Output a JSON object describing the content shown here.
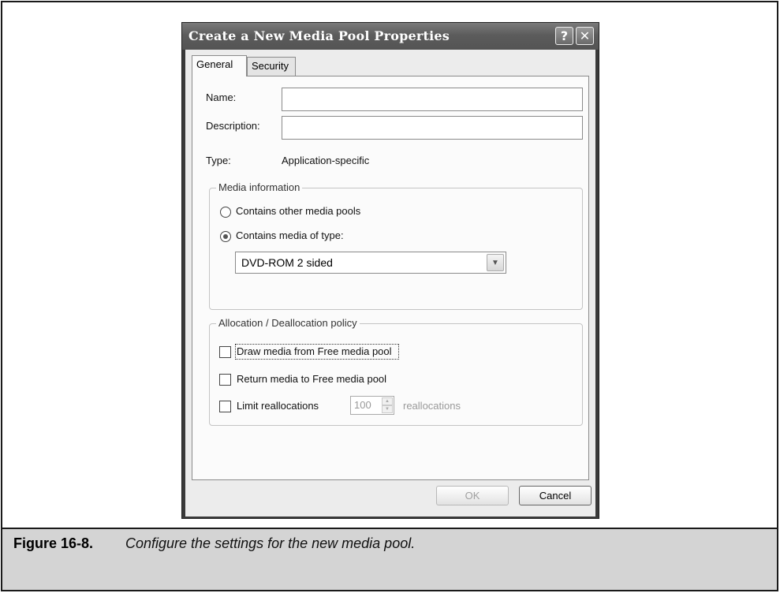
{
  "dialog": {
    "title": "Create a New Media Pool Properties",
    "help_glyph": "?",
    "close_glyph": "✕"
  },
  "tabs": [
    {
      "label": "General",
      "active": true
    },
    {
      "label": "Security",
      "active": false
    }
  ],
  "general": {
    "name_label": "Name:",
    "name_value": "",
    "description_label": "Description:",
    "description_value": "",
    "type_label": "Type:",
    "type_value": "Application-specific"
  },
  "media_info": {
    "group_title": "Media information",
    "radio_other_pools": {
      "label": "Contains other media pools",
      "checked": false
    },
    "radio_media_type": {
      "label": "Contains media of type:",
      "checked": true
    },
    "media_type_selected": "DVD-ROM 2 sided"
  },
  "allocation": {
    "group_title": "Allocation / Deallocation policy",
    "draw_media": {
      "label": "Draw media from Free media pool",
      "checked": false
    },
    "return_media": {
      "label": "Return media to Free media pool",
      "checked": false
    },
    "limit_realloc": {
      "label": "Limit reallocations",
      "checked": false
    },
    "realloc_count": "100",
    "realloc_unit": "reallocations"
  },
  "buttons": {
    "ok": "OK",
    "cancel": "Cancel"
  },
  "caption": {
    "label": "Figure 16-8.",
    "text": "Configure the settings for the new media pool."
  }
}
